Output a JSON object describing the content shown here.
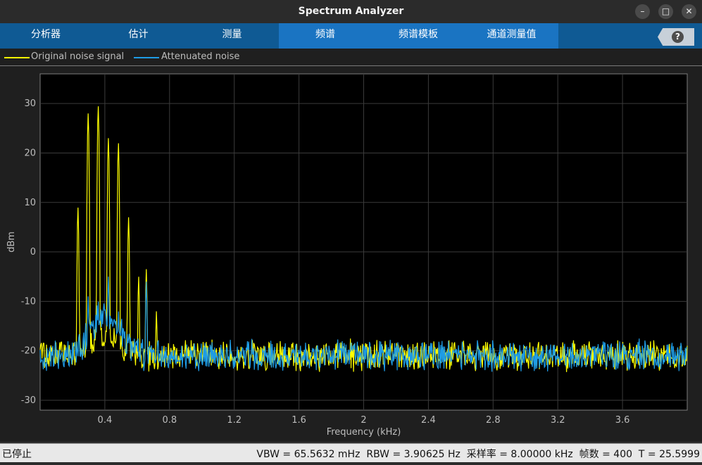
{
  "window": {
    "title": "Spectrum Analyzer",
    "minimize_glyph": "–",
    "maximize_glyph": "□",
    "close_glyph": "✕"
  },
  "toolstrip": {
    "tabs": [
      "分析器",
      "估计",
      "测量",
      "频谱",
      "频谱模板",
      "通道测量值"
    ],
    "help_glyph": "?",
    "colors": {
      "strip": "#0f5a94",
      "active_group": "#1a74c2"
    }
  },
  "legend": {
    "items": [
      {
        "label": "Original noise signal",
        "color": "#ffff00"
      },
      {
        "label": "Attenuated noise",
        "color": "#1e9ce6"
      }
    ]
  },
  "status": {
    "left": "已停止",
    "vbw": "VBW = 65.5632 mHz",
    "rbw": "RBW = 3.90625 Hz",
    "sample_rate": "采样率 = 8.00000 kHz",
    "frames": "帧数 = 400",
    "time": "T = 25.5999"
  },
  "chart_data": {
    "type": "line",
    "xlabel": "Frequency (kHz)",
    "ylabel": "dBm",
    "xlim": [
      0,
      4
    ],
    "ylim": [
      -32,
      36
    ],
    "xticks": [
      0.4,
      0.8,
      1.2,
      1.6,
      2,
      2.4,
      2.8,
      3.2,
      3.6
    ],
    "xtick_labels": [
      "0.4",
      "0.8",
      "1.2",
      "1.6",
      "2",
      "2.4",
      "2.8",
      "3.2",
      "3.6"
    ],
    "yticks": [
      30,
      20,
      10,
      0,
      -10,
      -20,
      -30
    ],
    "ytick_labels": [
      "30",
      "20",
      "10",
      "0",
      "-10",
      "-20",
      "-30"
    ],
    "grid": true,
    "background": "#000000",
    "noise_floor_dbm": -21,
    "series": [
      {
        "name": "Original noise signal",
        "color": "#ffff00",
        "peaks": [
          {
            "x": 0.234,
            "y": 9
          },
          {
            "x": 0.297,
            "y": 28
          },
          {
            "x": 0.359,
            "y": 29.5
          },
          {
            "x": 0.422,
            "y": 23
          },
          {
            "x": 0.484,
            "y": 22
          },
          {
            "x": 0.547,
            "y": 7
          },
          {
            "x": 0.609,
            "y": -5
          },
          {
            "x": 0.656,
            "y": -3.5
          },
          {
            "x": 0.719,
            "y": -12
          }
        ]
      },
      {
        "name": "Attenuated noise",
        "color": "#1e9ce6",
        "peaks": [
          {
            "x": 0.297,
            "y": -9
          },
          {
            "x": 0.359,
            "y": -10
          },
          {
            "x": 0.422,
            "y": -5
          },
          {
            "x": 0.484,
            "y": -12
          },
          {
            "x": 0.656,
            "y": -6
          }
        ]
      }
    ]
  }
}
